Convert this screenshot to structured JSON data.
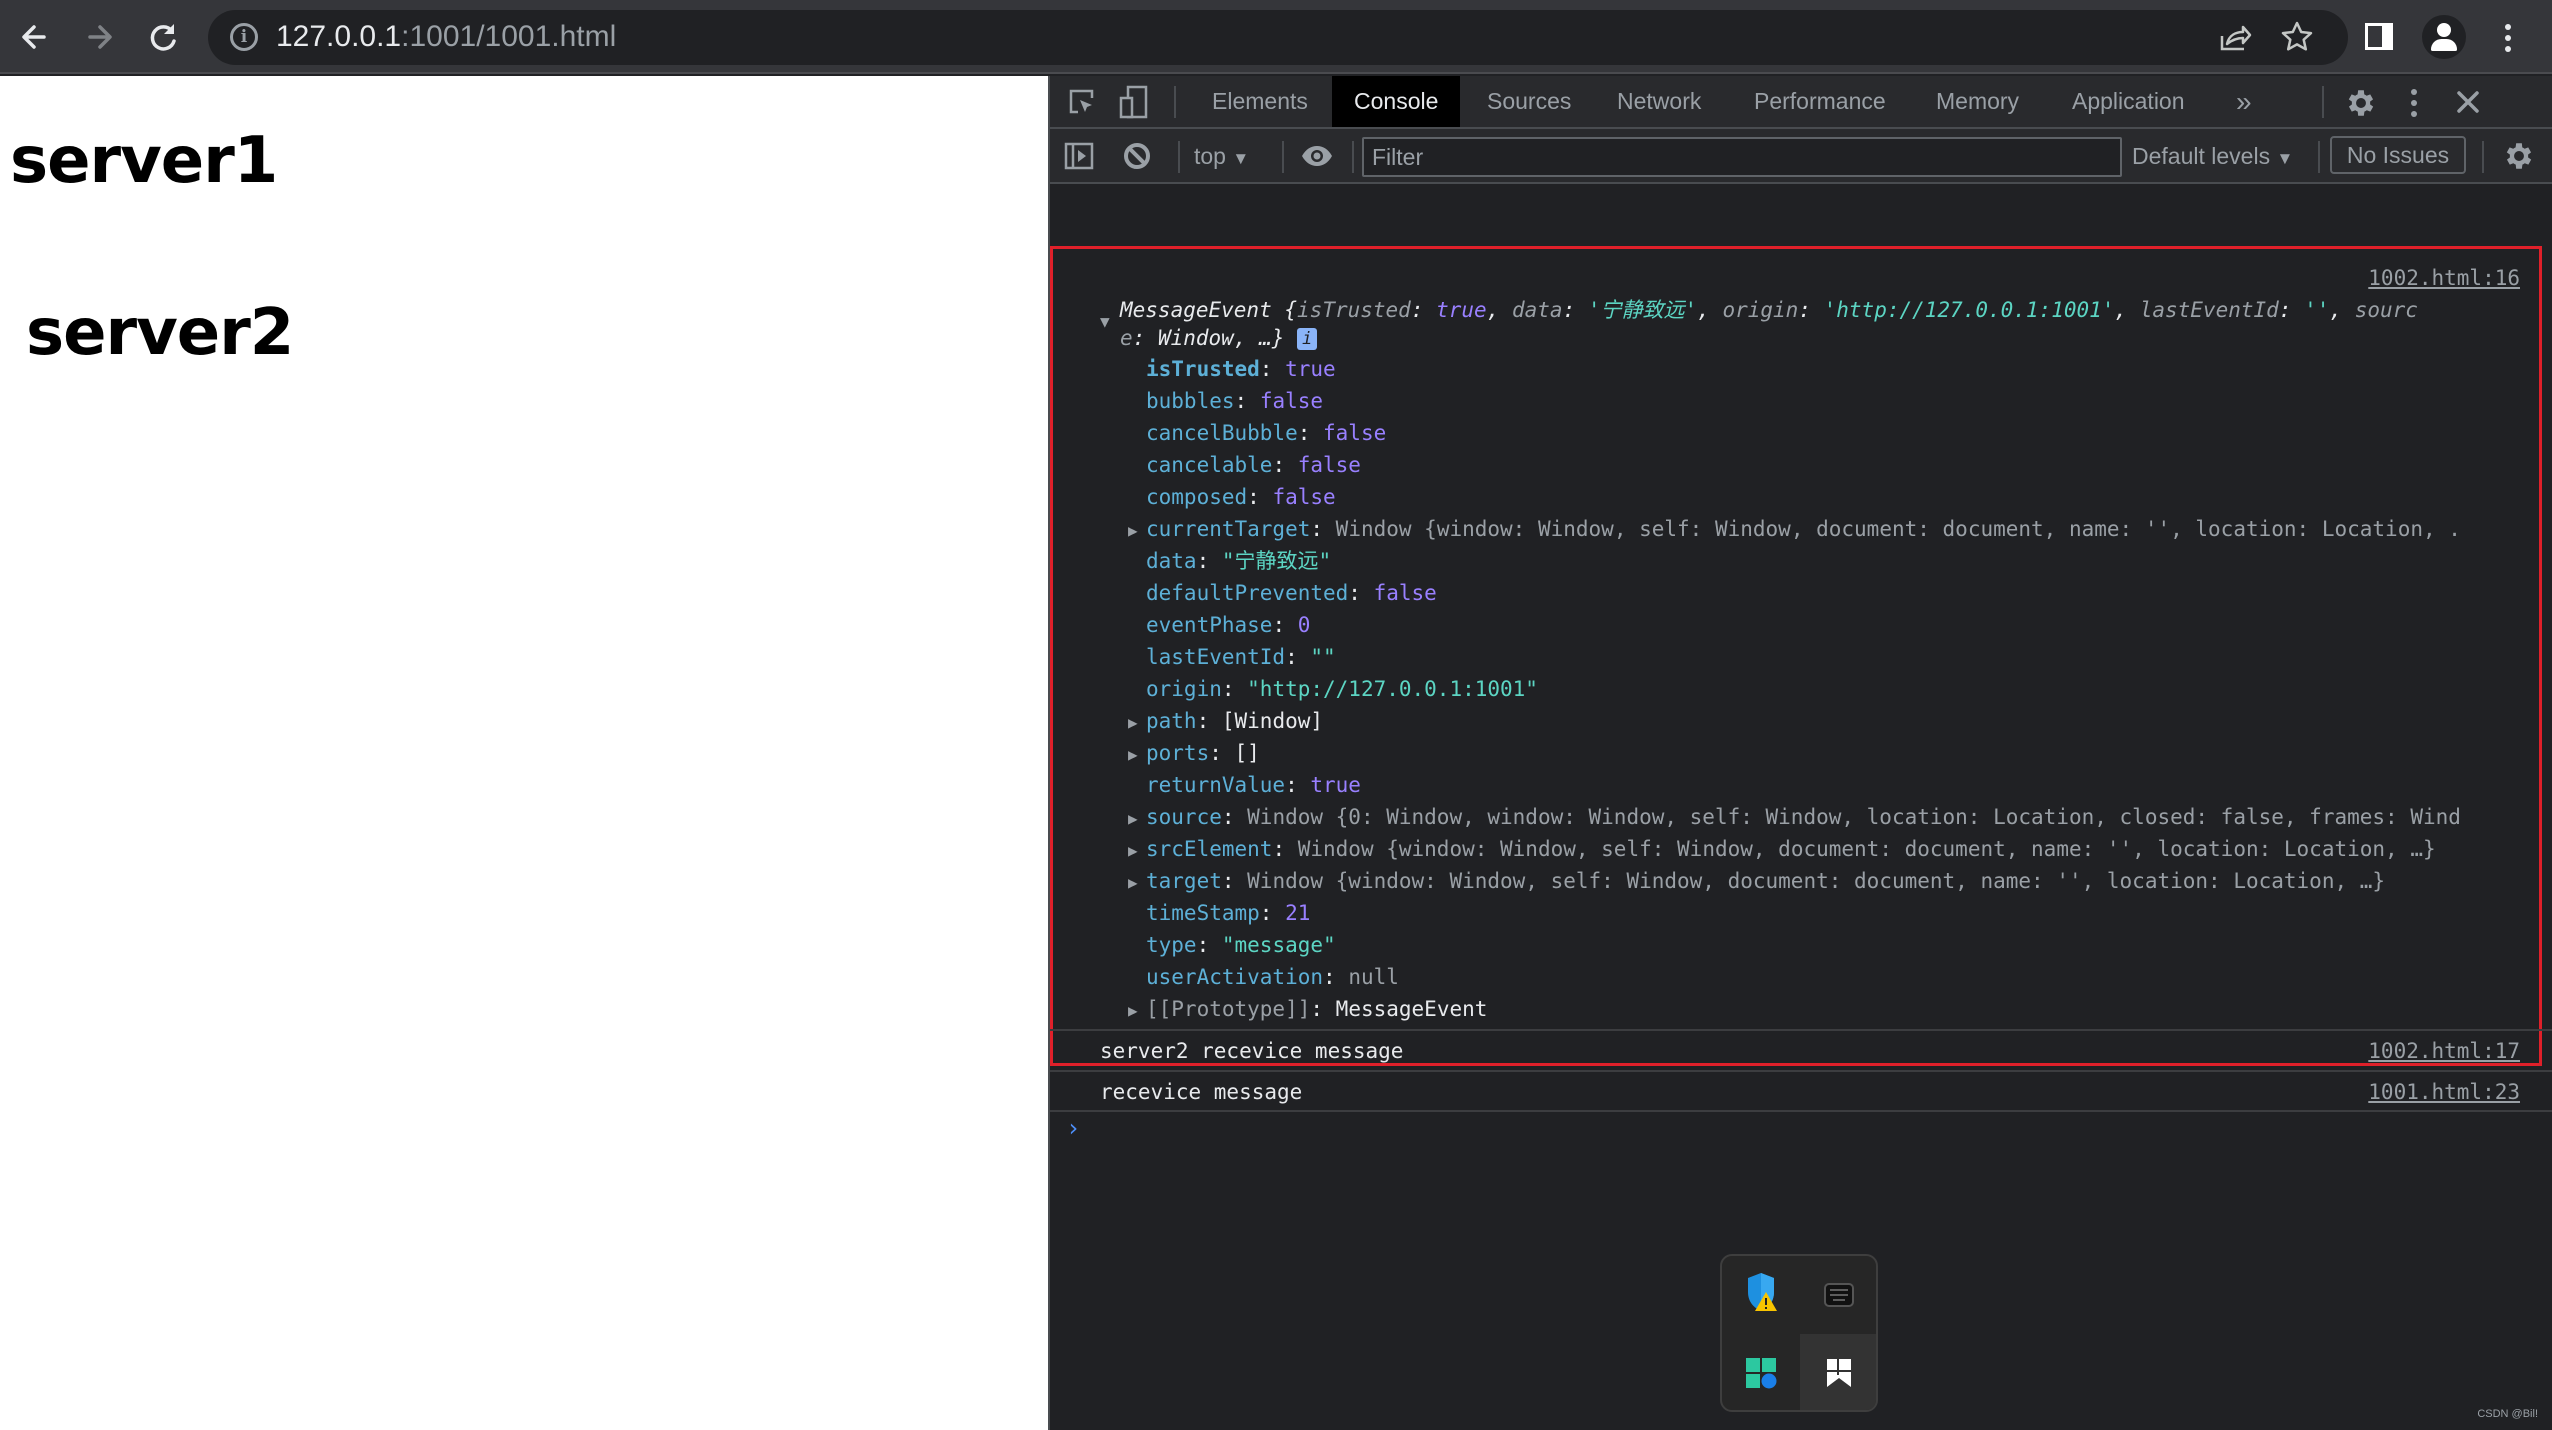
{
  "browser": {
    "url_host": "127.0.0.1",
    "url_rest": ":1001/1001.html",
    "icons": [
      "back-icon",
      "forward-icon",
      "reload-icon",
      "info-icon",
      "share-icon",
      "bookmark-star-icon",
      "side-panel-icon",
      "profile-icon",
      "menu-kebab-icon"
    ]
  },
  "page": {
    "heading1": "server1",
    "heading2": "server2"
  },
  "devtools": {
    "tabs": [
      {
        "label": "Elements",
        "active": false
      },
      {
        "label": "Console",
        "active": true
      },
      {
        "label": "Sources",
        "active": false
      },
      {
        "label": "Network",
        "active": false
      },
      {
        "label": "Performance",
        "active": false
      },
      {
        "label": "Memory",
        "active": false
      },
      {
        "label": "Application",
        "active": false
      }
    ],
    "more_tabs": "»",
    "toolbar": {
      "context": "top",
      "filter_placeholder": "Filter",
      "levels": "Default levels",
      "issues": "No Issues"
    },
    "console": {
      "entries": [
        {
          "source": "1002.html:16",
          "summary": {
            "class": "MessageEvent",
            "isTrusted": "true",
            "data": "'宁静致远'",
            "origin": "'http://127.0.0.1:1001'",
            "lastEventId": "''",
            "tail_line1": "sourc",
            "tail_line2_key": "e",
            "tail_line2_val": "Window",
            "ellipsis": "…}"
          },
          "props": {
            "isTrusted": "true",
            "bubbles": "false",
            "cancelBubble": "false",
            "cancelable": "false",
            "composed": "false",
            "currentTarget": "Window {window: Window, self: Window, document: document, name: '', location: Location, .",
            "data": "\"宁静致远\"",
            "defaultPrevented": "false",
            "eventPhase": "0",
            "lastEventId": "\"\"",
            "origin": "\"http://127.0.0.1:1001\"",
            "path": "[Window]",
            "ports": "[]",
            "returnValue": "true",
            "source": "Window {0: Window, window: Window, self: Window, location: Location, closed: false, frames: Wind",
            "srcElement": "Window {window: Window, self: Window, document: document, name: '', location: Location, …}",
            "target": "Window {window: Window, self: Window, document: document, name: '', location: Location, …}",
            "timeStamp": "21",
            "type": "\"message\"",
            "userActivation": "null",
            "prototype_key": "[[Prototype]]",
            "prototype_val": "MessageEvent"
          }
        },
        {
          "text": "server2 recevice message",
          "source": "1002.html:17"
        },
        {
          "text": "recevice message",
          "source": "1001.html:23"
        }
      ],
      "prompt": "›"
    }
  },
  "tray": {
    "icons": [
      "windows-security-warning-icon",
      "touch-keyboard-icon",
      "app-launcher-icon",
      "bookmark-app-icon"
    ]
  },
  "watermark": "CSDN @Bil!"
}
